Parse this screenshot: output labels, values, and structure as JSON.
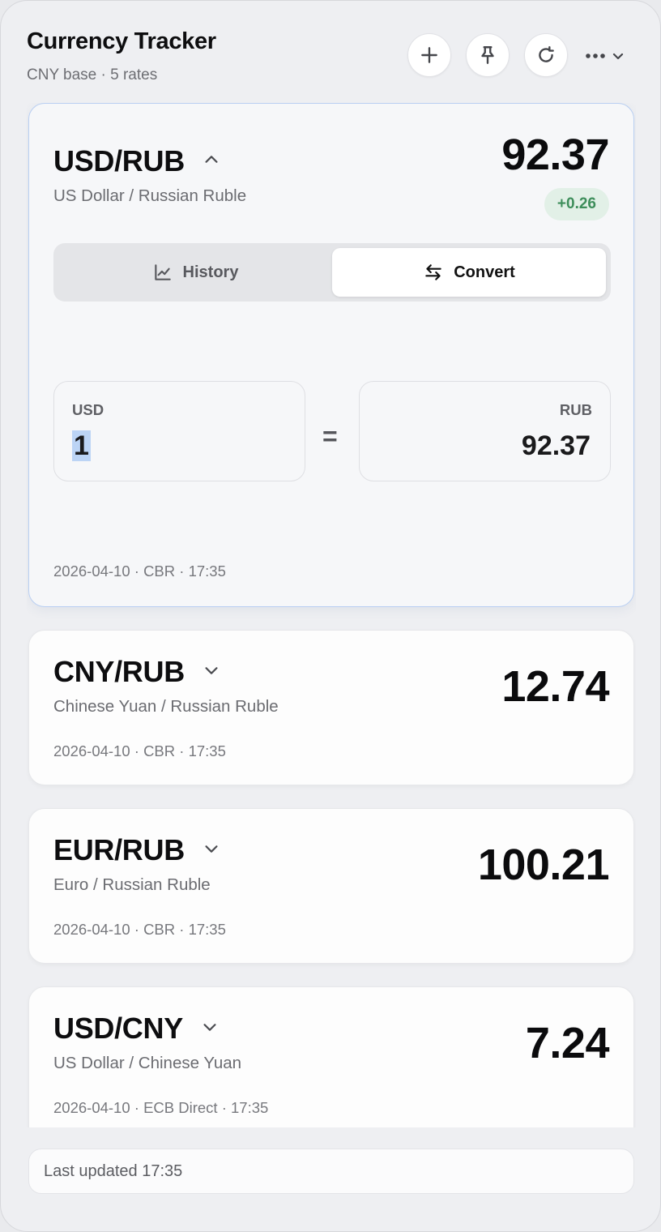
{
  "header": {
    "title": "Currency Tracker",
    "subtitle": "CNY base · 5 rates",
    "buttons": [
      "plus-icon",
      "pin-icon",
      "refresh-icon",
      "more-icon"
    ]
  },
  "cards": [
    {
      "pair": "USD/RUB",
      "name": "US Dollar / Russian Ruble",
      "rate": "92.37",
      "change": "+0.26",
      "meta": "2026-04-10 · CBR · 17:35",
      "expanded": true,
      "tabs": [
        {
          "label": "History",
          "icon": "chart-line-icon",
          "active": false
        },
        {
          "label": "Convert",
          "icon": "swap-arrows-icon",
          "active": true
        }
      ],
      "converter": {
        "from_code": "USD",
        "from_value": "1",
        "equals": "=",
        "to_code": "RUB",
        "to_value": "92.37"
      }
    },
    {
      "pair": "CNY/RUB",
      "name": "Chinese Yuan / Russian Ruble",
      "rate": "12.74",
      "meta": "2026-04-10 · CBR · 17:35"
    },
    {
      "pair": "EUR/RUB",
      "name": "Euro / Russian Ruble",
      "rate": "100.21",
      "meta": "2026-04-10 · CBR · 17:35"
    },
    {
      "pair": "USD/CNY",
      "name": "US Dollar / Chinese Yuan",
      "rate": "7.24",
      "meta": "2026-04-10 · ECB Direct · 17:35"
    }
  ],
  "footer": {
    "last_updated": "Last updated 17:35"
  },
  "colors": {
    "accent_border": "#b9cff2",
    "positive": "#3e8e5b",
    "positive_bg": "#e2f0e7"
  }
}
